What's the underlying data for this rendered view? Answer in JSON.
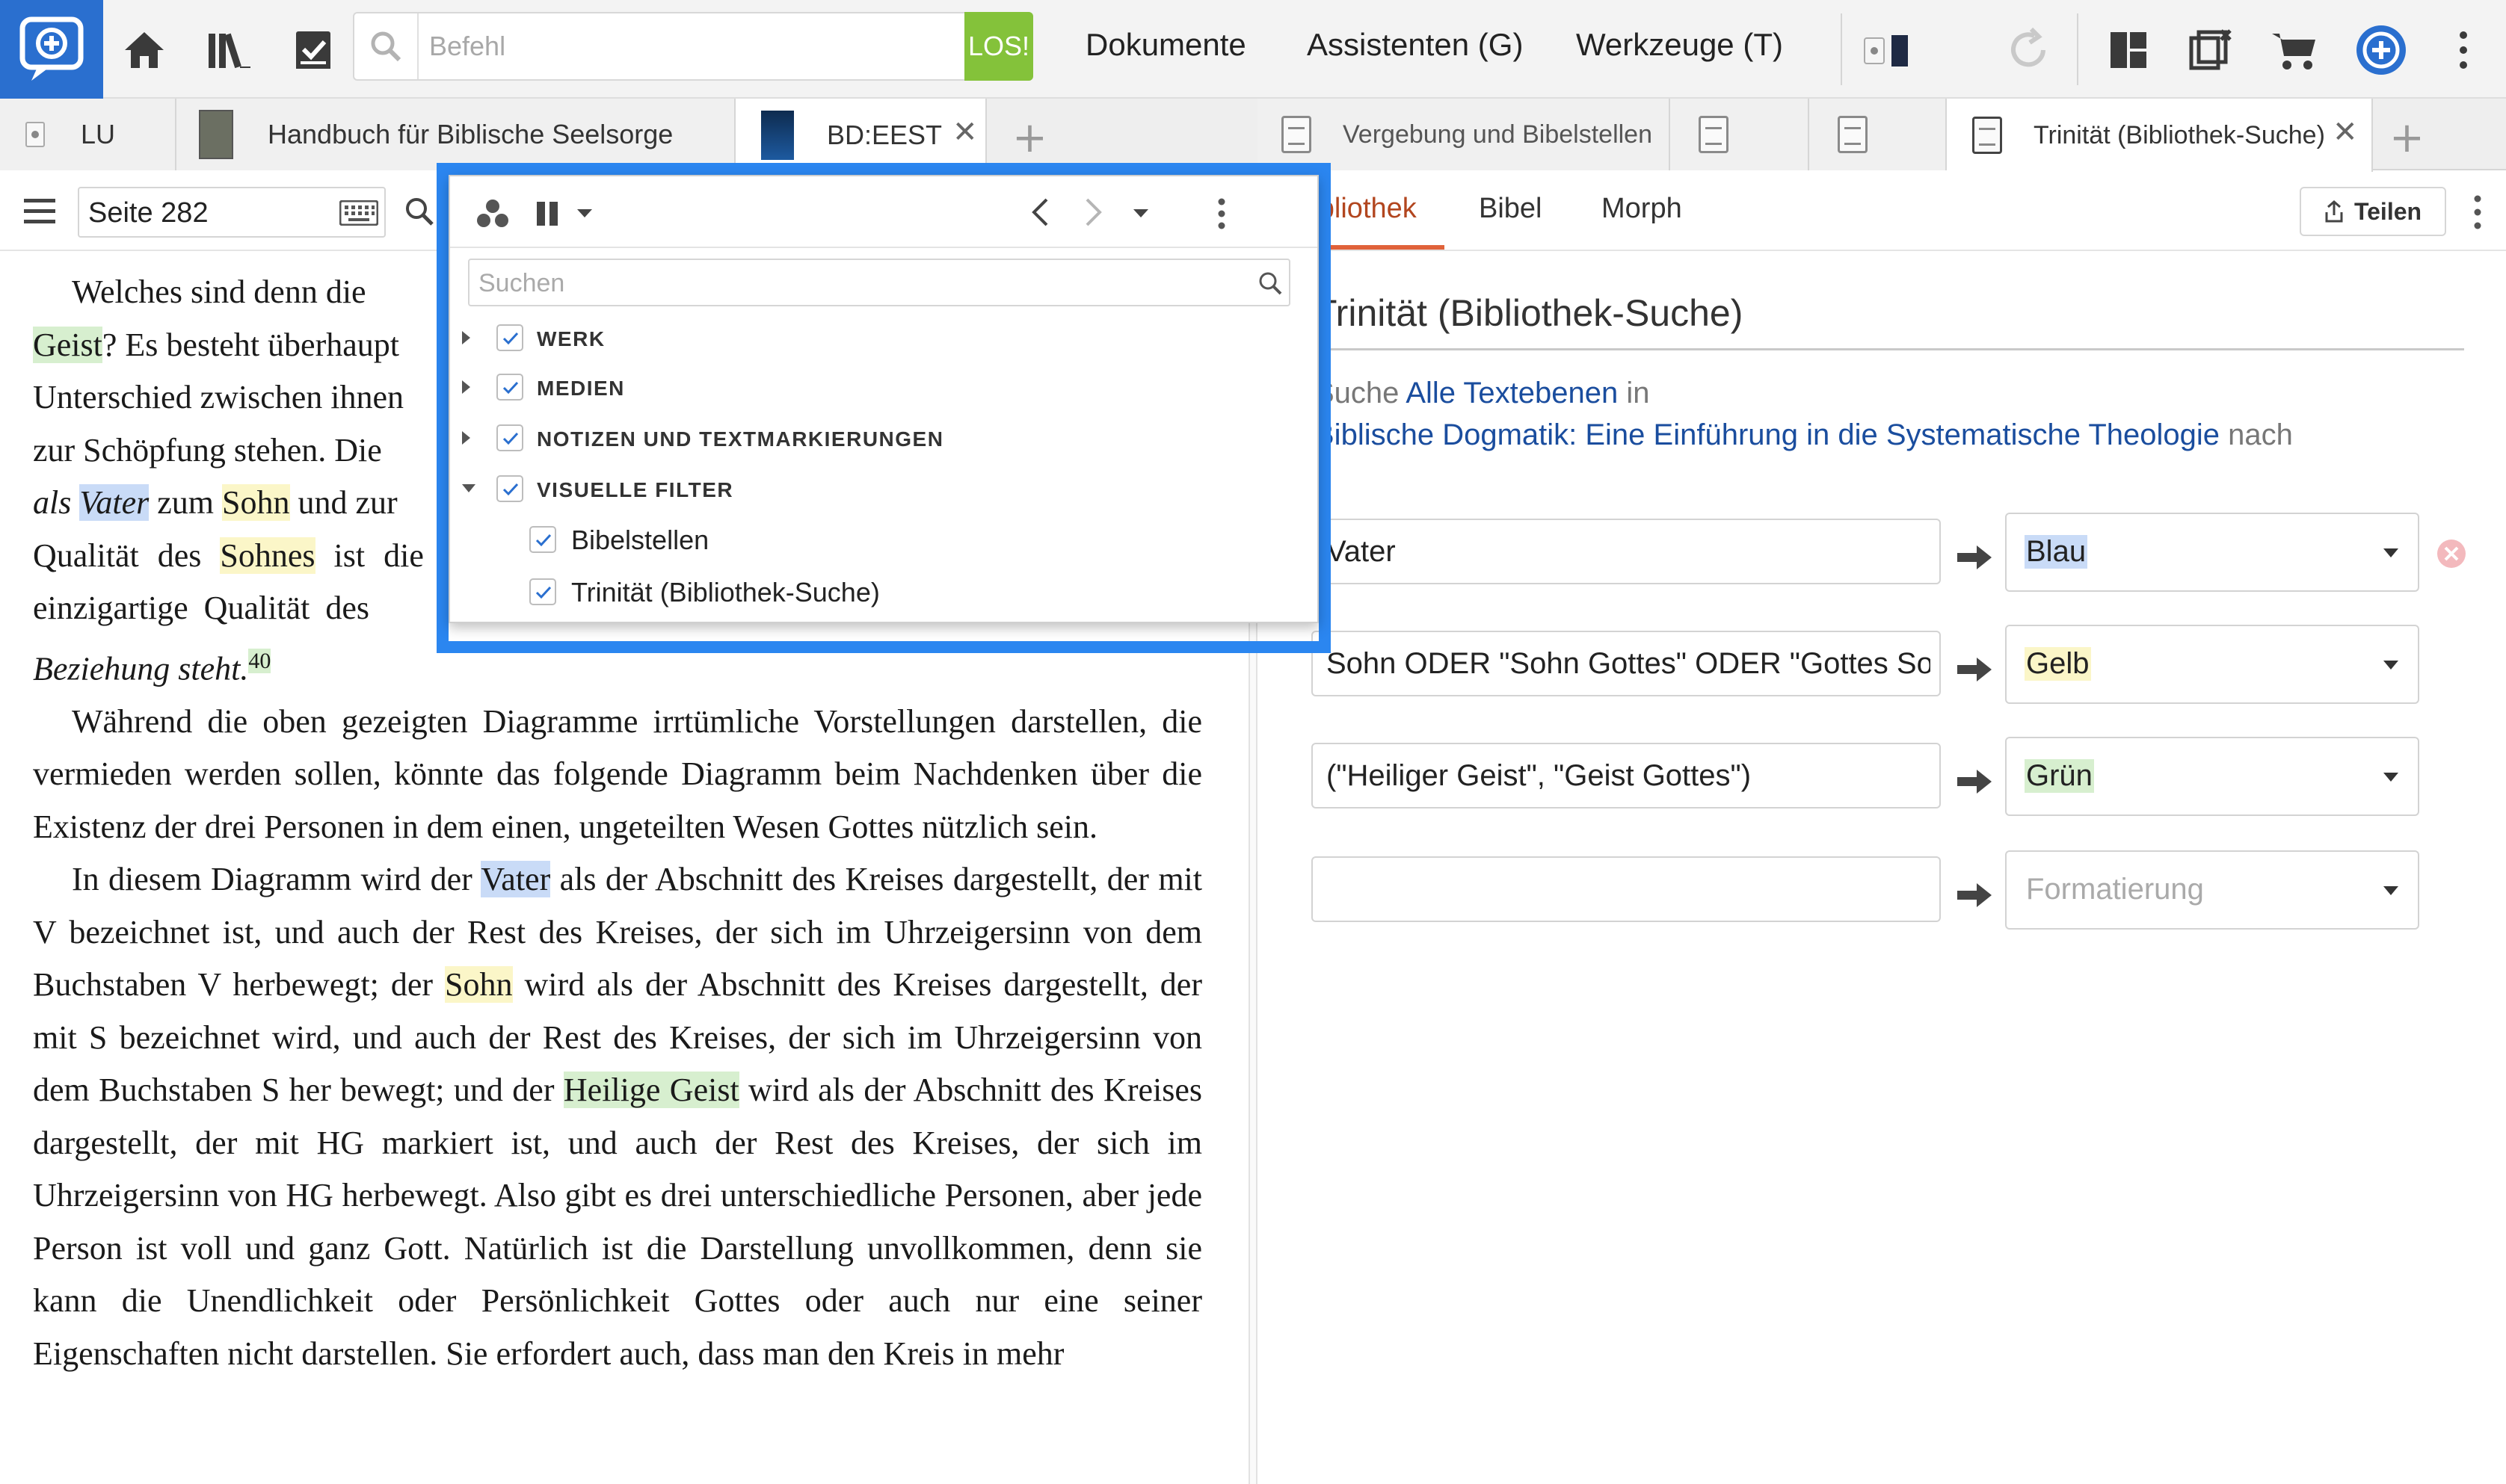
{
  "toolbar": {
    "command_placeholder": "Befehl",
    "go_label": "LOS!",
    "menu_documents": "Dokumente",
    "menu_assistants": "Assistenten (G)",
    "menu_tools": "Werkzeuge (T)"
  },
  "left_tabs": [
    {
      "label": "LU"
    },
    {
      "label": "Handbuch für Biblische Seelsorge"
    },
    {
      "label": "BD:EEST"
    }
  ],
  "right_tabs": [
    {
      "label": "Vergebung und Bibelstellen"
    },
    {
      "label": ""
    },
    {
      "label": ""
    },
    {
      "label": "Trinität (Bibliothek-Suche)"
    }
  ],
  "left_panel": {
    "page_value": "Seite 282",
    "reader": {
      "p1": [
        "Welches sind denn die",
        "Geist",
        "? Es besteht überhaupt",
        "Unterschied zwischen ihnen",
        "zur Schöpfung stehen. Die",
        "als ",
        "Vater",
        " zum ",
        "Sohn",
        " und zur",
        "Qualität des ",
        "Sohnes",
        " ist die",
        "einzigartige Qualität des ",
        "Beziehung steht.",
        "40"
      ],
      "p2": "Während die oben gezeigten Diagramme irrtümliche Vorstellungen darstellen, die vermieden werden sollen, könnte das folgende Diagramm beim Nachdenken über die Existenz der drei Personen in dem einen, ungeteilten Wesen Gottes nützlich sein.",
      "p3": [
        "In diesem Diagramm wird der ",
        "Vater",
        " als der Abschnitt des Kreises dargestellt, der mit V bezeichnet ist, und auch der Rest des Kreises, der sich im Uhrzeigersinn von dem Buchstaben V herbewegt; der ",
        "Sohn",
        " wird als der Abschnitt des Kreises dargestellt, der mit S bezeichnet wird, und auch der Rest des Kreises, der sich im Uhrzeigersinn von dem Buchstaben S her bewegt; und der ",
        "Heilige Geist",
        " wird als der Abschnitt des Kreises dargestellt, der mit HG markiert ist, und auch der Rest des Kreises, der sich im Uhrzeigersinn von HG herbewegt. Also gibt es drei unterschiedliche Personen, aber jede Person ist voll und ganz Gott. Natürlich ist die Darstellung unvollkommen, denn sie kann die Unendlichkeit oder Persönlichkeit Gottes oder auch nur eine seiner Eigenschaften nicht darstellen. Sie erfordert auch, dass man den Kreis in mehr"
      ]
    }
  },
  "popup": {
    "search_placeholder": "Suchen",
    "filters": [
      {
        "label": "WERK",
        "checked": true
      },
      {
        "label": "MEDIEN",
        "checked": true
      },
      {
        "label": "NOTIZEN UND TEXTMARKIERUNGEN",
        "checked": true
      },
      {
        "label": "VISUELLE FILTER",
        "checked": true
      },
      {
        "label": "Bibelstellen",
        "checked": true
      },
      {
        "label": "Trinität (Bibliothek-Suche)",
        "checked": true
      }
    ]
  },
  "right_panel": {
    "tabs": [
      "Bibliothek",
      "Bibel",
      "Morph"
    ],
    "share_label": "Teilen",
    "title": "Trinität (Bibliothek-Suche)",
    "line1_prefix": "Suche ",
    "line1_link": "Alle Textebenen",
    "line1_suffix": " in",
    "line2_link": "Biblische Dogmatik: Eine Einführung in die Systematische Theologie",
    "line2_suffix": " nach",
    "rules": [
      {
        "term": "Vater",
        "format": "Blau"
      },
      {
        "term": "Sohn ODER \"Sohn Gottes\" ODER \"Gottes Sohn\"",
        "format": "Gelb"
      },
      {
        "term": "(\"Heiliger Geist\", \"Geist Gottes\")",
        "format": "Grün"
      },
      {
        "term": "",
        "format": "Formatierung"
      }
    ]
  },
  "colors": {
    "accent_blue": "#2b86f0",
    "go_green": "#84c23a",
    "highlight_blue": "#c9dbf7",
    "highlight_yellow": "#fbf6c8",
    "highlight_green": "#d7efcf",
    "tab_underline": "#e0623a"
  }
}
